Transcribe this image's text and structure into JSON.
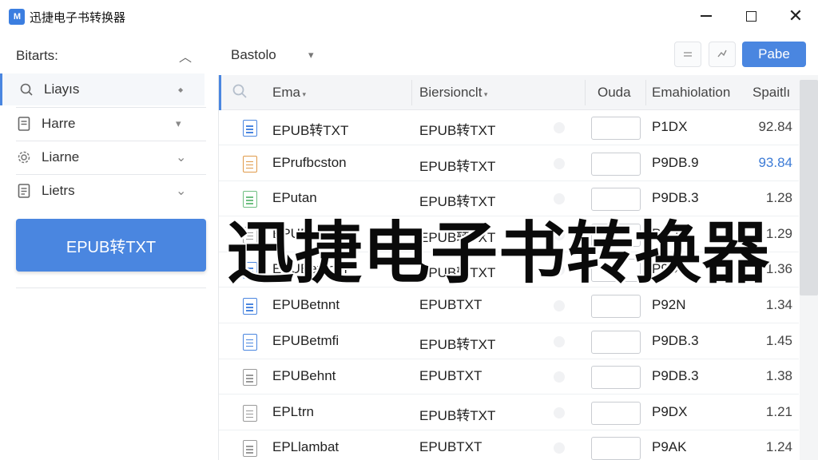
{
  "app": {
    "logo_text": "M",
    "title": "迅捷电子书转换器"
  },
  "window_controls": {
    "minimize_icon": "minimize-icon",
    "maximize_icon": "maximize-icon",
    "close_icon": "close-icon"
  },
  "sidebar": {
    "header": "Bitarts:",
    "items": [
      {
        "label": "Liayıs",
        "icon": "search-icon",
        "chevron": "◆"
      },
      {
        "label": "Harre",
        "icon": "file-icon",
        "chevron": "▾"
      },
      {
        "label": "Liarne",
        "icon": "gear-icon",
        "chevron": "⌄"
      },
      {
        "label": "Lietrs",
        "icon": "document-icon",
        "chevron": "⌄"
      }
    ],
    "convert_button": "EPUB转TXT"
  },
  "toolbar": {
    "title": "Bastolo",
    "page_button": "Pabe"
  },
  "table": {
    "columns": [
      "Ema",
      "Biersionclt",
      "Ouda",
      "Emahiolation",
      "Spaitlı"
    ],
    "rows": [
      {
        "icon": "blue",
        "name": "EPUB转TXT",
        "format": "EPUB转TXT",
        "em": "P1DX",
        "sp": "92.84",
        "sp_blue": false
      },
      {
        "icon": "orange",
        "name": "EPrufbcston",
        "format": "EPUB转TXT",
        "em": "P9DB.9",
        "sp": "93.84",
        "sp_blue": true
      },
      {
        "icon": "green",
        "name": "EPutan",
        "format": "EPUB转TXT",
        "em": "P9DB.3",
        "sp": "1.28",
        "sp_blue": false
      },
      {
        "icon": "gray",
        "name": "EPUBcan",
        "format": "EPUB转TXT",
        "em": "P9DB",
        "sp": "1.29",
        "sp_blue": false
      },
      {
        "icon": "blue",
        "name": "EPUBetdom",
        "format": "EPUB转TXT",
        "em": "P9DB",
        "sp": "1.36",
        "sp_blue": false
      },
      {
        "icon": "blue",
        "name": "EPUBetnnt",
        "format": "EPUBTXT",
        "em": "P92N",
        "sp": "1.34",
        "sp_blue": false
      },
      {
        "icon": "blue",
        "name": "EPUBetmfi",
        "format": "EPUB转TXT",
        "em": "P9DB.3",
        "sp": "1.45",
        "sp_blue": false
      },
      {
        "icon": "gray",
        "name": "EPUBehnt",
        "format": "EPUBTXT",
        "em": "P9DB.3",
        "sp": "1.38",
        "sp_blue": false
      },
      {
        "icon": "gray",
        "name": "EPLtrn",
        "format": "EPUB转TXT",
        "em": "P9DX",
        "sp": "1.21",
        "sp_blue": false
      },
      {
        "icon": "gray",
        "name": "EPLlambat",
        "format": "EPUBTXT",
        "em": "P9AK",
        "sp": "1.24",
        "sp_blue": false
      }
    ]
  },
  "overlay": {
    "title": "迅捷电子书转换器"
  },
  "colors": {
    "accent": "#4a86e0",
    "link_blue": "#3c7bd6",
    "header_bg": "#f4f5f7"
  }
}
